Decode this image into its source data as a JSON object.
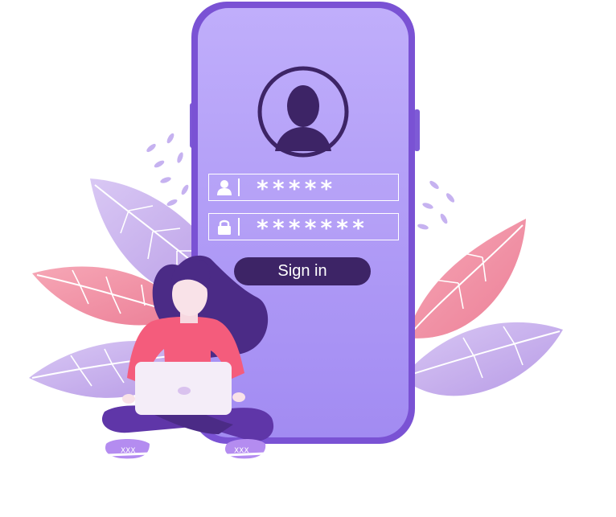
{
  "login": {
    "username_value": "*****",
    "password_value": "*******",
    "sign_in_label": "Sign in"
  },
  "icons": {
    "avatar": "user-silhouette-icon",
    "username": "user-icon",
    "password": "lock-icon"
  },
  "colors": {
    "phone_body": "#a58cf5",
    "phone_screen": "#b7a3f8",
    "phone_frame_dark": "#6f48c9",
    "button": "#3d2466",
    "accent_pink": "#f48fa4",
    "accent_lavender": "#c9b6f2"
  }
}
